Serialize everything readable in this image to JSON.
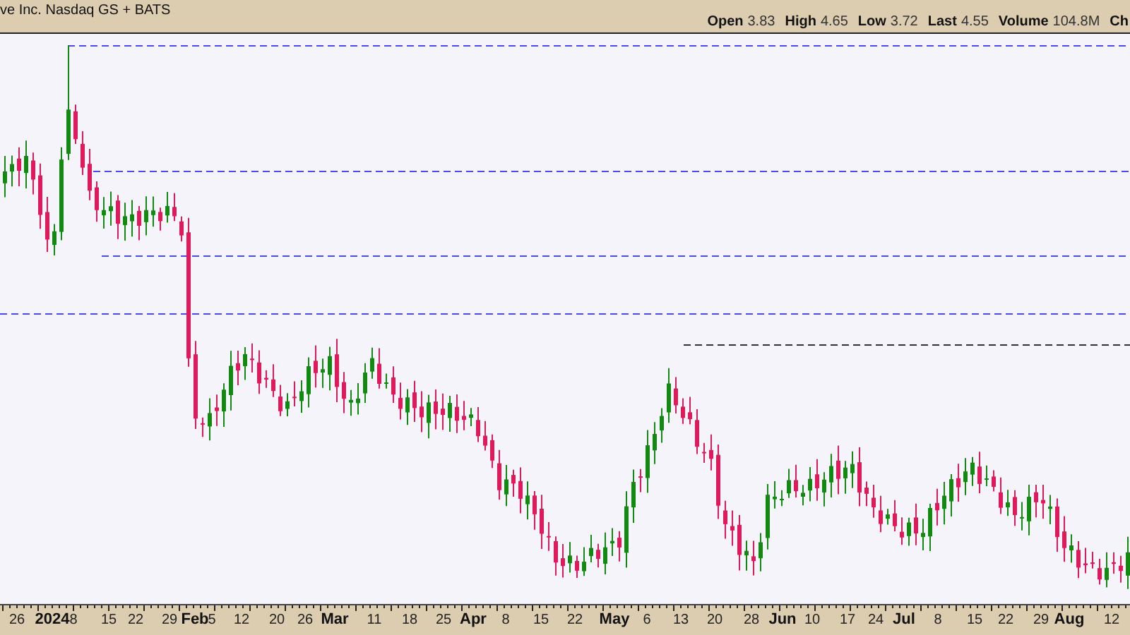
{
  "header": {
    "title": "ve Inc.  Nasdaq GS + BATS",
    "quotes": [
      {
        "label": "Open",
        "value": "3.83"
      },
      {
        "label": "High",
        "value": "4.65"
      },
      {
        "label": "Low",
        "value": "3.72"
      },
      {
        "label": "Last",
        "value": "4.55"
      },
      {
        "label": "Volume",
        "value": "104.8M"
      },
      {
        "label": "Ch"
      }
    ]
  },
  "x_axis": {
    "labels": [
      {
        "text": "26",
        "major": false
      },
      {
        "text": "2024",
        "major": true
      },
      {
        "text": "8",
        "major": false
      },
      {
        "text": "15",
        "major": false
      },
      {
        "text": "22",
        "major": false
      },
      {
        "text": "29",
        "major": false
      },
      {
        "text": "Feb",
        "major": true
      },
      {
        "text": "5",
        "major": false
      },
      {
        "text": "12",
        "major": false
      },
      {
        "text": "20",
        "major": false
      },
      {
        "text": "26",
        "major": false
      },
      {
        "text": "Mar",
        "major": true
      },
      {
        "text": "11",
        "major": false
      },
      {
        "text": "18",
        "major": false
      },
      {
        "text": "25",
        "major": false
      },
      {
        "text": "Apr",
        "major": true
      },
      {
        "text": "8",
        "major": false
      },
      {
        "text": "15",
        "major": false
      },
      {
        "text": "22",
        "major": false
      },
      {
        "text": "May",
        "major": true
      },
      {
        "text": "6",
        "major": false
      },
      {
        "text": "13",
        "major": false
      },
      {
        "text": "20",
        "major": false
      },
      {
        "text": "28",
        "major": false
      },
      {
        "text": "Jun",
        "major": true
      },
      {
        "text": "10",
        "major": false
      },
      {
        "text": "17",
        "major": false
      },
      {
        "text": "24",
        "major": false
      },
      {
        "text": "Jul",
        "major": true
      },
      {
        "text": "8",
        "major": false
      },
      {
        "text": "15",
        "major": false
      },
      {
        "text": "22",
        "major": false
      },
      {
        "text": "29",
        "major": false
      },
      {
        "text": "Aug",
        "major": true
      },
      {
        "text": "12",
        "major": false
      }
    ]
  }
}
